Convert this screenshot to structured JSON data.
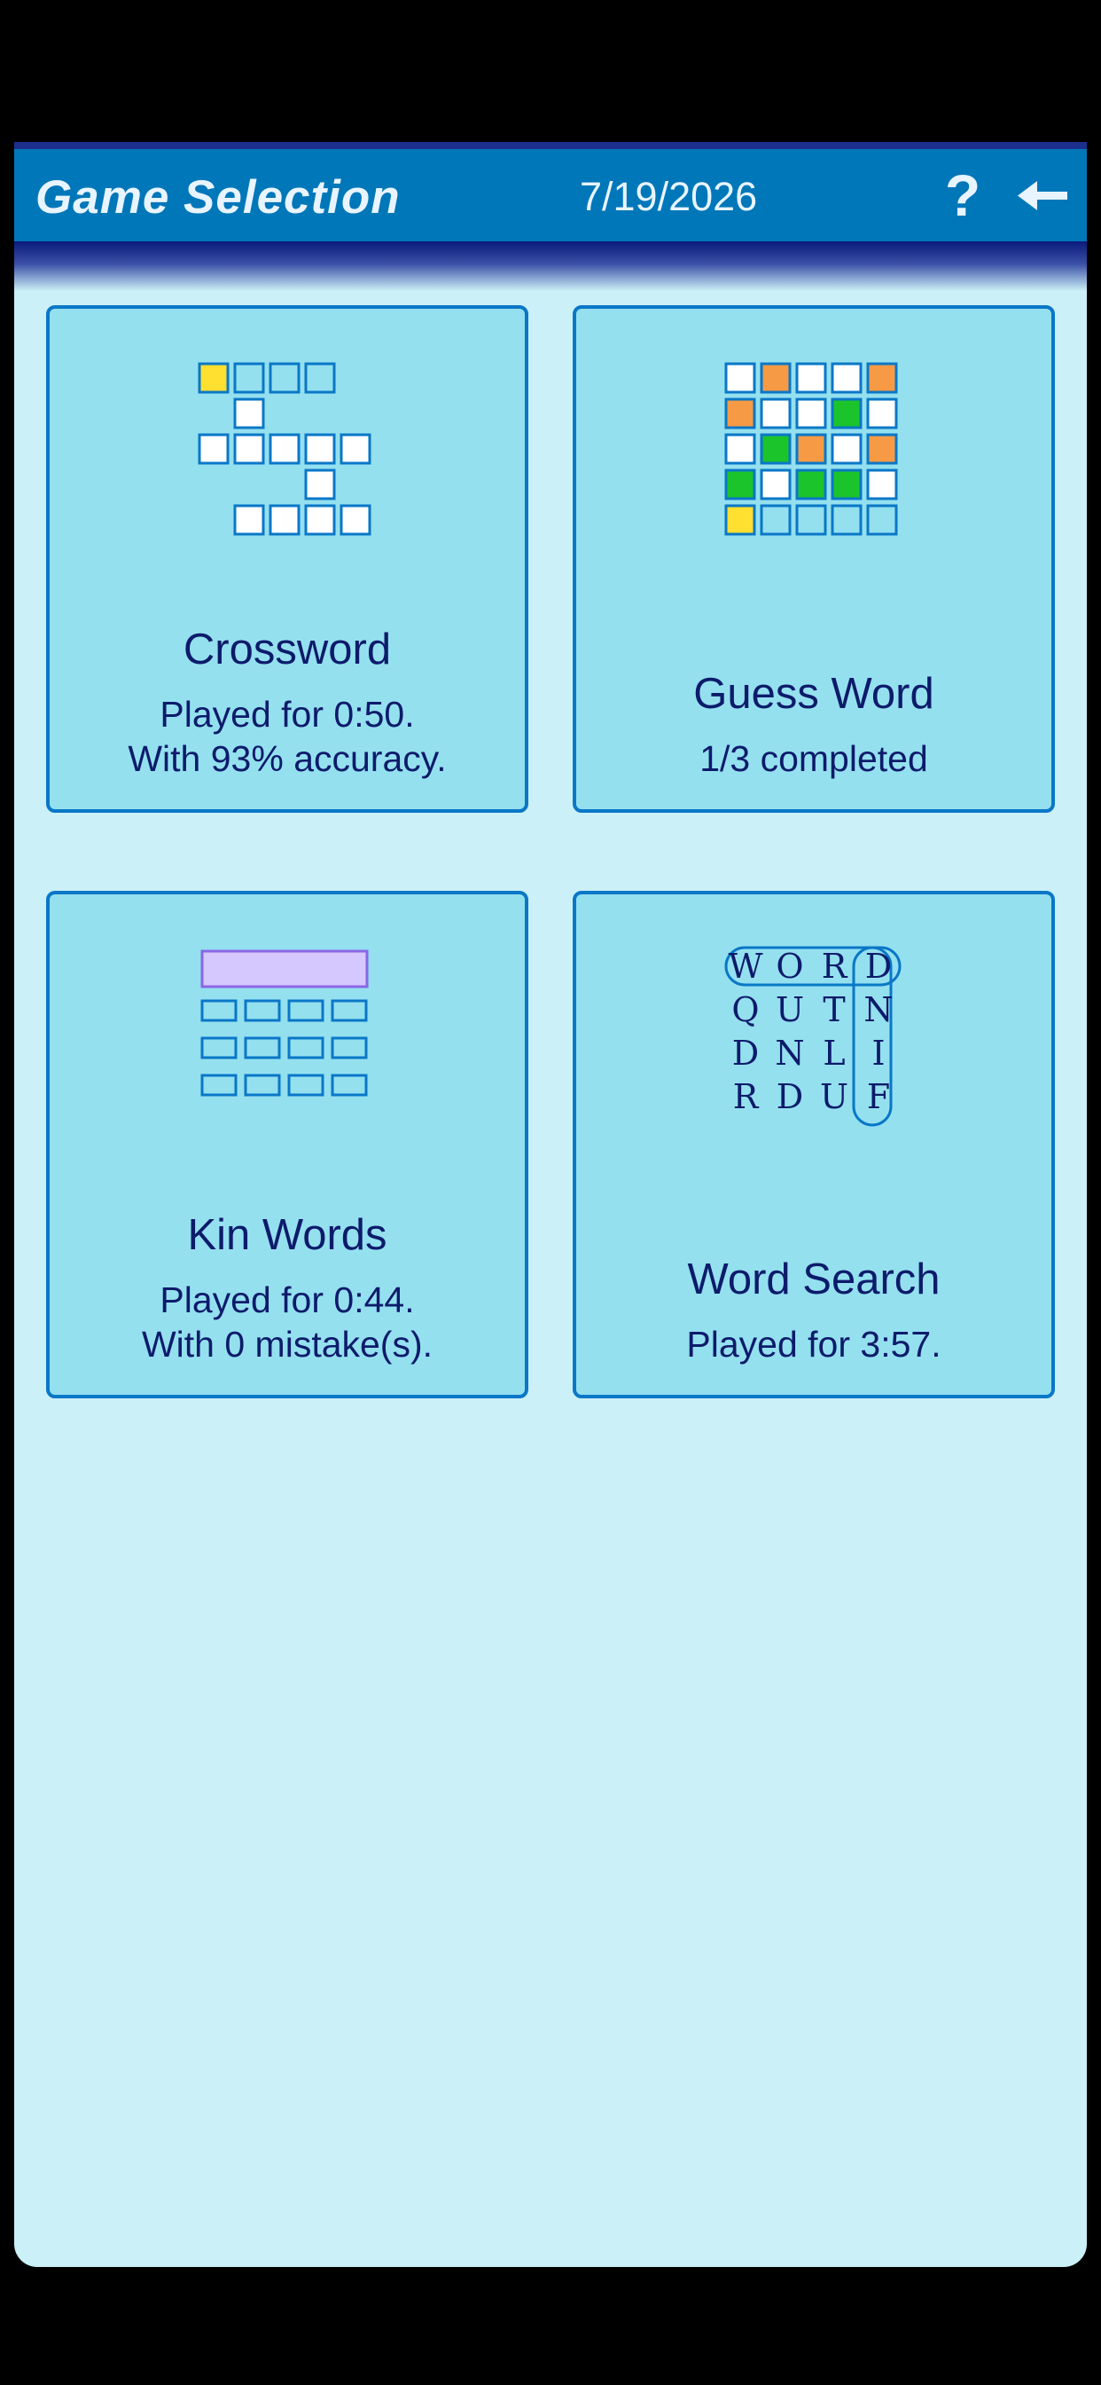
{
  "header": {
    "title": "Game Selection",
    "date": "7/19/2026",
    "help_icon": "question-mark-icon",
    "back_icon": "left-arrow-icon"
  },
  "colors": {
    "header_bg": "#0077b9",
    "screen_bg": "#cbf0f7",
    "card_bg": "#94e0ef",
    "card_border": "#0a77c7",
    "text_dark": "#0d1b6b",
    "tile_yellow": "#ffe030",
    "tile_orange": "#f79a45",
    "tile_green": "#1bc42b",
    "kin_purple": "#d5c7ff"
  },
  "games": [
    {
      "name": "Crossword",
      "line1": "Played for 0:50.",
      "line2": "With 93% accuracy.",
      "icon": "crossword-grid-icon"
    },
    {
      "name": "Guess Word",
      "line1": "1/3 completed",
      "icon": "guess-word-grid-icon"
    },
    {
      "name": "Kin Words",
      "line1": "Played for 0:44.",
      "line2": "With 0 mistake(s).",
      "icon": "kin-words-grid-icon"
    },
    {
      "name": "Word Search",
      "line1": "Played for 3:57.",
      "icon": "word-search-grid-icon",
      "letters": [
        [
          "W",
          "O",
          "R",
          "D"
        ],
        [
          "Q",
          "U",
          "T",
          "N"
        ],
        [
          "D",
          "N",
          "L",
          "I"
        ],
        [
          "R",
          "D",
          "U",
          "F"
        ]
      ]
    }
  ]
}
